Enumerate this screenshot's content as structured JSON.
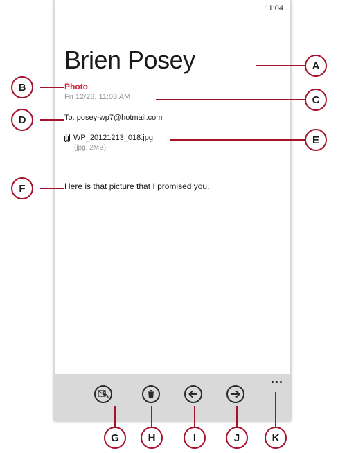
{
  "status_bar": {
    "time": "11:04"
  },
  "message": {
    "sender": "Brien Posey",
    "subject": "Photo",
    "date": "Fri 12/28, 11:03 AM",
    "to_label": "To:",
    "to_address": "posey-wp7@hotmail.com",
    "attachment": {
      "name": "WP_20121213_018.jpg",
      "meta": "(jpg, 2MB)"
    },
    "body": "Here is that picture that I promised you."
  },
  "app_bar": {
    "buttons": [
      {
        "name": "respond",
        "icon": "reply-envelope-icon"
      },
      {
        "name": "delete",
        "icon": "trash-icon"
      },
      {
        "name": "previous",
        "icon": "arrow-left-icon"
      },
      {
        "name": "next",
        "icon": "arrow-right-icon"
      }
    ],
    "more_icon": "ellipsis-icon"
  },
  "callouts": [
    "A",
    "B",
    "C",
    "D",
    "E",
    "F",
    "G",
    "H",
    "I",
    "J",
    "K"
  ],
  "colors": {
    "accent": "#d6223b",
    "callout": "#a5122b",
    "app_bar": "#d9d9d9"
  }
}
